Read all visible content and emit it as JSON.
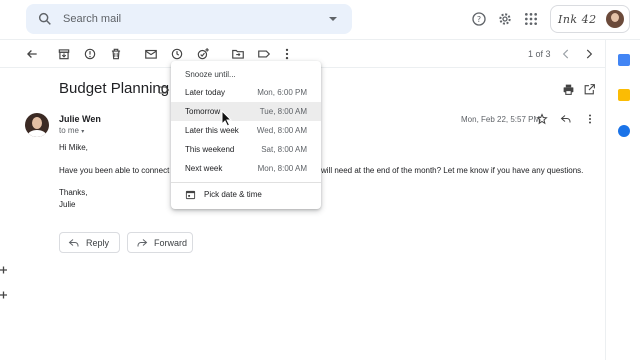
{
  "search": {
    "placeholder": "Search mail"
  },
  "brand": {
    "logo_text": "Ink 42"
  },
  "toolbar": {
    "page_count": "1 of 3"
  },
  "message": {
    "subject": "Budget Planning",
    "sender": "Julie Wen",
    "to": "to me",
    "date": "Mon, Feb 22, 5:57 PM",
    "body": [
      "Hi Mike,",
      "Have you been able to connect w",
      "will need at the end of the month? Let me know if you have any questions.",
      "Thanks,",
      "Julie"
    ]
  },
  "actions": {
    "reply": "Reply",
    "forward": "Forward"
  },
  "snooze_menu": {
    "header": "Snooze until...",
    "options": [
      {
        "label": "Later today",
        "time": "Mon, 6:00 PM"
      },
      {
        "label": "Tomorrow",
        "time": "Tue, 8:00 AM"
      },
      {
        "label": "Later this week",
        "time": "Wed, 8:00 AM"
      },
      {
        "label": "This weekend",
        "time": "Sat, 8:00 AM"
      },
      {
        "label": "Next week",
        "time": "Mon, 8:00 AM"
      }
    ],
    "pick": "Pick date & time"
  },
  "colors": {
    "search_bg": "#eaf1fb",
    "icon": "#5f6368",
    "hover_row": "#ececec",
    "rail_calendar": "#4285f4",
    "rail_keep": "#fbbc04",
    "rail_tasks": "#1a73e8"
  }
}
